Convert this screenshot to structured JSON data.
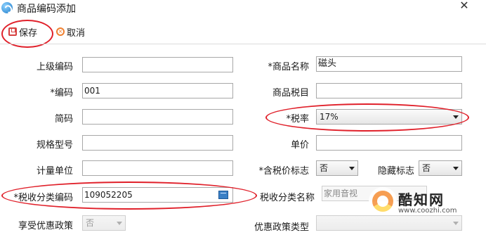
{
  "window": {
    "title": "商品编码添加",
    "close_glyph": "✕"
  },
  "toolbar": {
    "save_label": "保存",
    "cancel_label": "取消"
  },
  "form": {
    "parent_code": {
      "label": "上级编码",
      "value": ""
    },
    "product_name": {
      "label": "*商品名称",
      "value": "磁头"
    },
    "code": {
      "label": "*编码",
      "value": "001"
    },
    "tax_item": {
      "label": "商品税目",
      "value": ""
    },
    "short_code": {
      "label": "简码",
      "value": ""
    },
    "tax_rate": {
      "label": "*税率",
      "value": "17%"
    },
    "spec_model": {
      "label": "规格型号",
      "value": ""
    },
    "unit_price": {
      "label": "单价",
      "value": ""
    },
    "unit": {
      "label": "计量单位",
      "value": ""
    },
    "tax_included_flag": {
      "label": "*含税价标志",
      "value": "否"
    },
    "hidden_flag": {
      "label": "隐藏标志",
      "value": "否"
    },
    "tax_class_code": {
      "label": "*税收分类编码",
      "value": "109052205"
    },
    "tax_class_name": {
      "label": "税收分类名称",
      "value": "家用音视"
    },
    "preferential_policy": {
      "label": "享受优惠政策",
      "value": "否"
    },
    "policy_type": {
      "label": "优惠政策类型",
      "value": ""
    }
  },
  "watermark": {
    "name": "酷知网",
    "url": "www.coozhi.com"
  },
  "colors": {
    "highlight": "#e0202a",
    "save_icon": "#d64040",
    "cancel_icon": "#f08030"
  }
}
